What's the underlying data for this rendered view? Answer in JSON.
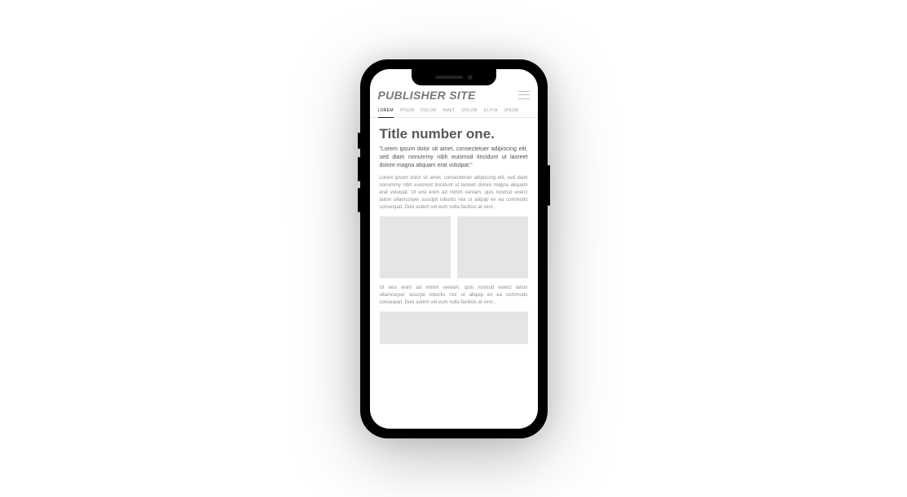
{
  "header": {
    "site_title": "PUBLISHER SITE"
  },
  "tabs": [
    {
      "label": "LOREM",
      "active": true
    },
    {
      "label": "IPSUM",
      "active": false
    },
    {
      "label": "DOLOR",
      "active": false
    },
    {
      "label": "AMET",
      "active": false
    },
    {
      "label": "DOLOR",
      "active": false
    },
    {
      "label": "ELITIA",
      "active": false
    },
    {
      "label": "IPSUM",
      "active": false
    }
  ],
  "article": {
    "title": "Title number one.",
    "lead": "\"Lorem ipsum dolor sit amet, consectetuer adipiscing elit, sed diam nonummy nibh euismod tincidunt ut laoreet dolore magna aliquam erat volutpat.\"",
    "para1": "Lorem ipsum dolor sit amet, consectetuer adipiscing elit, sed diam nonummy nibh euismod tincidunt ut laoreet dolore magna aliquam erat volutpat. Ut wisi enim ad minim veniam, quis nostrud exerci tation ullamcorper suscipit lobortis nisl ut aliquip ex ea commodo consequat. Duis autem vel eum nulla facilisis at vero .",
    "para2": "Ut wisi enim ad minim veniam, quis nostrud exerci tation ullamcorper suscipit lobortis nisl ut aliquip ex ea commodo consequat. Duis autem vel eum nulla facilisis at vero ."
  }
}
